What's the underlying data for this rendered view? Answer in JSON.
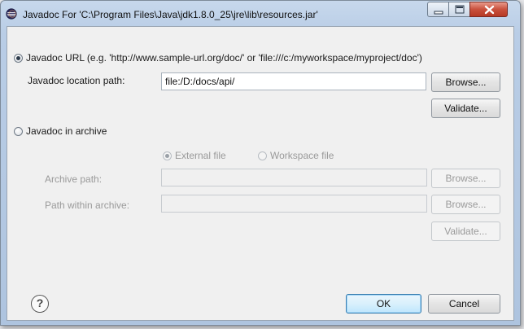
{
  "window": {
    "title": "Javadoc For 'C:\\Program Files\\Java\\jdk1.8.0_25\\jre\\lib\\resources.jar'"
  },
  "url_section": {
    "radio_label": "Javadoc URL (e.g. 'http://www.sample-url.org/doc/' or 'file:///c:/myworkspace/myproject/doc')",
    "selected": true,
    "location_label": "Javadoc location path:",
    "location_value": "file:/D:/docs/api/",
    "browse_label": "Browse...",
    "validate_label": "Validate..."
  },
  "archive_section": {
    "radio_label": "Javadoc in archive",
    "selected": false,
    "external_file_label": "External file",
    "workspace_file_label": "Workspace file",
    "archive_path_label": "Archive path:",
    "archive_path_value": "",
    "path_within_label": "Path within archive:",
    "path_within_value": "",
    "browse_label": "Browse...",
    "browse2_label": "Browse...",
    "validate_label": "Validate..."
  },
  "footer": {
    "help_glyph": "?",
    "ok_label": "OK",
    "cancel_label": "Cancel"
  },
  "icons": {
    "app": "eclipse-icon",
    "minimize": "minimize-icon",
    "maximize": "maximize-icon",
    "close": "close-icon",
    "help": "help-icon"
  },
  "colors": {
    "titlebar": "#b9cde6",
    "client_bg": "#f0f0f0",
    "close_button": "#c9503c",
    "default_button": "#bee6fd"
  }
}
